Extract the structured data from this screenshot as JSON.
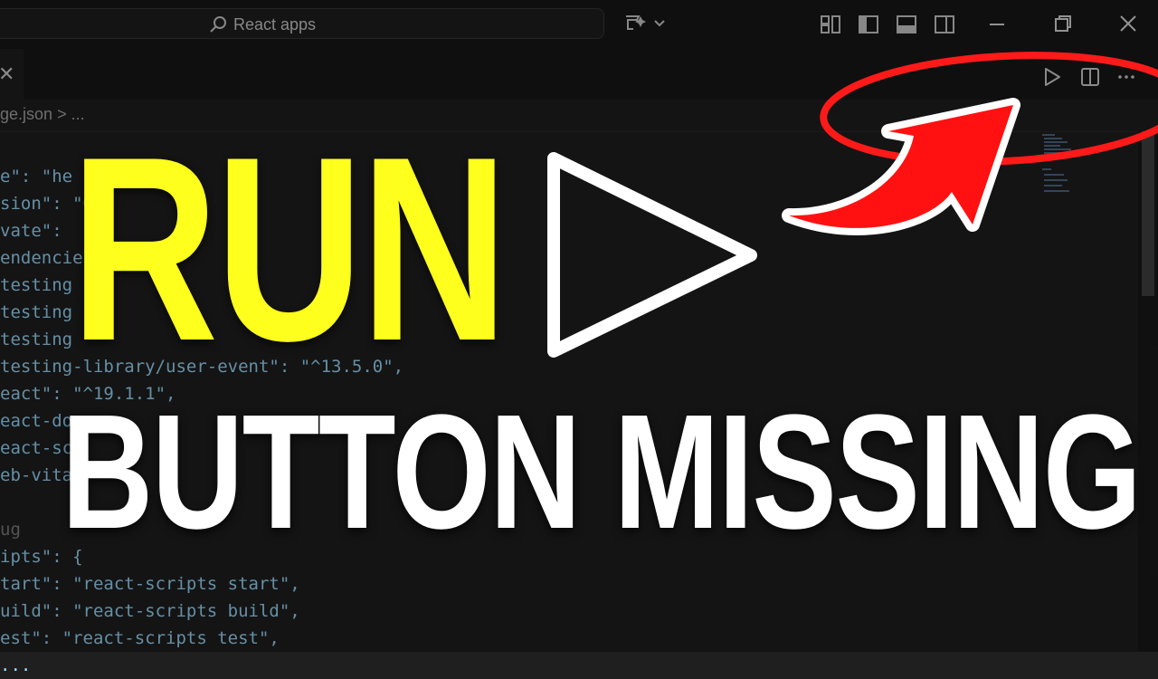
{
  "search": {
    "label": "React apps"
  },
  "breadcrumb": {
    "file": "ge.json",
    "separator": ">",
    "rest": "..."
  },
  "code_lines": [
    "e\": \"he",
    "sion\": \"0",
    "vate\":",
    "endencie",
    "testing",
    "testing",
    "testing",
    "testing-library/user-event\": \"^13.5.0\",",
    "eact\": \"^19.1.1\",",
    "eact-do",
    "eact-sc",
    "eb-vita",
    "",
    "ug",
    "ipts\": {",
    "tart\": \"react-scripts start\",",
    "uild\": \"react-scripts build\",",
    "est\": \"react-scripts test\",",
    "..."
  ],
  "overlay": {
    "run": "RUN",
    "missing": "BUTTON MISSING"
  },
  "colors": {
    "highlight_yellow": "#ffff1e",
    "arrow_red": "#ff1111",
    "ring_red": "#ff1a1a"
  },
  "icons": [
    "search-icon",
    "copilot-icon",
    "layout-icon",
    "minimize-icon",
    "restore-icon",
    "close-icon",
    "run-icon",
    "split-editor-icon",
    "more-icon",
    "play-triangle-icon"
  ]
}
